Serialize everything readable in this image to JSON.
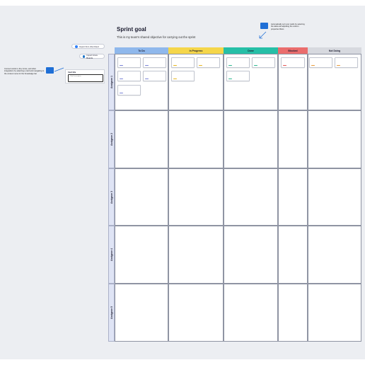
{
  "board": {
    "title": "Sprint goal",
    "subtitle": "This is my team's shared objective for carrying out the sprint",
    "tip_right": "Automatically sort your cards by selecting the table and adjusting the column properties filters",
    "tip_left": "Connect cards to Jira, Azure, and other integrations by selecting a card and navigating to the context menu for the Knowledge bar",
    "buttons": {
      "import_jira": "Import from Jira Cloud",
      "import_ado": "Import Azure Boards"
    },
    "card_widget": {
      "label": "Card title",
      "placeholder": "Title\nDescription"
    },
    "columns": [
      {
        "label": "To Do",
        "color": "#8fb8ec"
      },
      {
        "label": "In Progress",
        "color": "#f5d64a"
      },
      {
        "label": "Done",
        "color": "#26bfa7"
      },
      {
        "label": "Blocked",
        "color": "#ea6d6d"
      },
      {
        "label": "Not Doing",
        "color": "#d7d9df"
      }
    ],
    "swimlanes": [
      {
        "label": "Assignee 1"
      },
      {
        "label": "Assignee 2"
      },
      {
        "label": "Assignee 3"
      },
      {
        "label": "Assignee 4"
      },
      {
        "label": "Assignee 5"
      }
    ],
    "tag_colors": {
      "todo": "#7a83d6",
      "progress": "#e6b61e",
      "done": "#2fb891",
      "blocked": "#e25555",
      "notdoing": "#e89a3a"
    }
  }
}
